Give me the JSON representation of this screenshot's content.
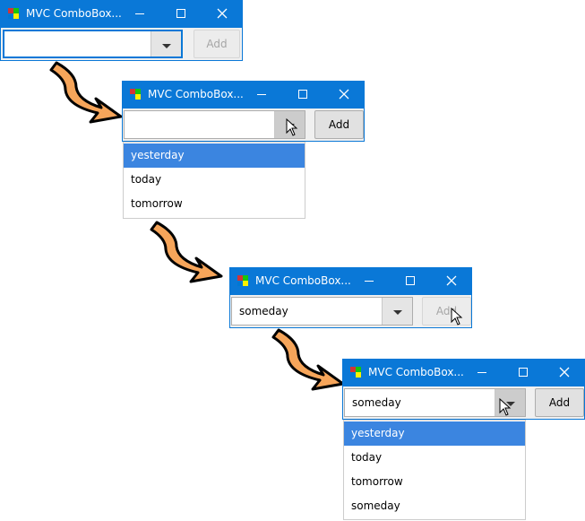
{
  "window_title": "MVC ComboBox...",
  "add_label": "Add",
  "windows": [
    {
      "combo_value": "",
      "add_enabled": false
    },
    {
      "combo_value": "",
      "add_enabled": true
    },
    {
      "combo_value": "someday",
      "add_enabled": false
    },
    {
      "combo_value": "someday",
      "add_enabled": true
    }
  ],
  "dropdown1": {
    "items": [
      "yesterday",
      "today",
      "tomorrow"
    ],
    "selected": "yesterday"
  },
  "dropdown2": {
    "items": [
      "yesterday",
      "today",
      "tomorrow",
      "someday"
    ],
    "selected": "yesterday"
  },
  "colors": {
    "titlebar": "#0a78d7",
    "selection": "#3b85e0",
    "arrow": "#f6a55a"
  },
  "icons": [
    "app-icon",
    "minimize-icon",
    "maximize-icon",
    "close-icon",
    "dropdown-arrow-icon",
    "mouse-cursor-icon",
    "flow-arrow"
  ]
}
